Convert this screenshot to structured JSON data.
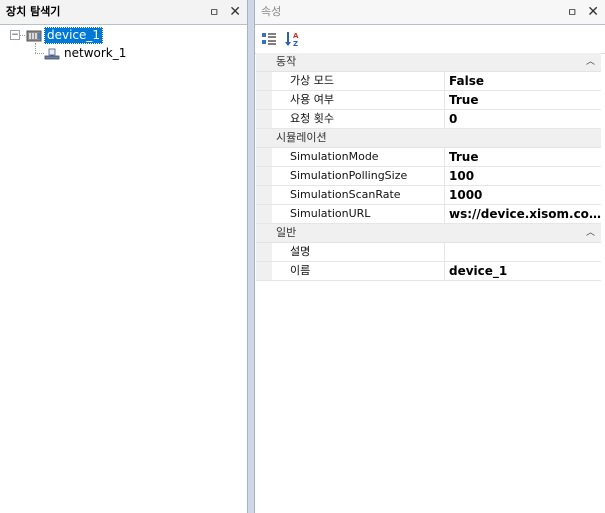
{
  "explorer": {
    "title": "장치 탐색기",
    "pin_glyph": "ㅁ",
    "close_glyph": "✕",
    "nodes": [
      {
        "label": "device_1",
        "expander": "−",
        "icon": "device-icon"
      },
      {
        "label": "network_1",
        "icon": "network-icon"
      }
    ]
  },
  "properties": {
    "title": "속성",
    "pin_glyph": "ㅁ",
    "close_glyph": "✕",
    "toolbar": {
      "categorized_icon": "categorized-view-icon",
      "alphabetical_icon": "sort-az-icon",
      "az_text": "AZ"
    },
    "categories": [
      {
        "name": "동작",
        "rows": [
          {
            "name": "가상 모드",
            "value": "False"
          },
          {
            "name": "사용 여부",
            "value": "True"
          },
          {
            "name": "요청 횟수",
            "value": "0"
          }
        ]
      },
      {
        "name": "시뮬레이션",
        "rows": [
          {
            "name": "SimulationMode",
            "value": "True"
          },
          {
            "name": "SimulationPollingSize",
            "value": "100"
          },
          {
            "name": "SimulationScanRate",
            "value": "1000"
          },
          {
            "name": "SimulationURL",
            "value": "ws://device.xisom.com/..."
          }
        ]
      },
      {
        "name": "일반",
        "rows": [
          {
            "name": "설명",
            "value": ""
          },
          {
            "name": "이름",
            "value": "device_1"
          }
        ]
      }
    ],
    "collapse_glyph": "︿"
  },
  "colors": {
    "selection": "#0078d7",
    "background": "#cfd6e5"
  }
}
